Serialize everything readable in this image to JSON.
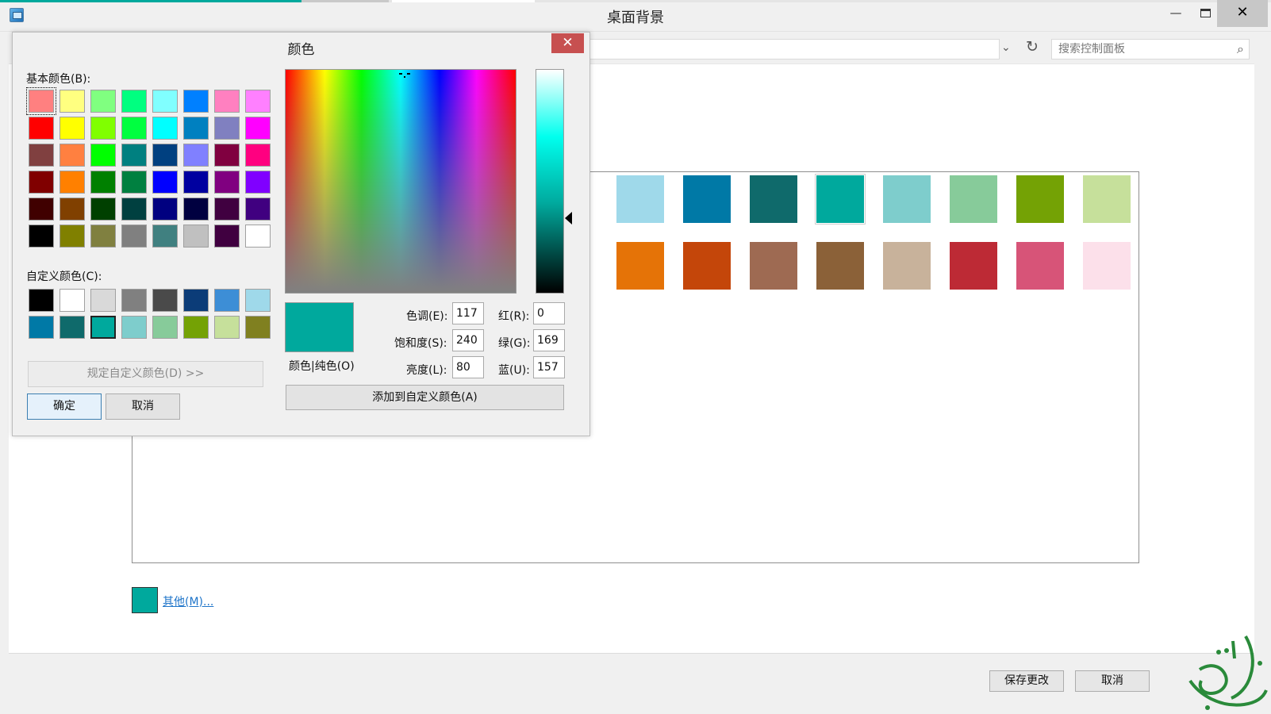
{
  "window": {
    "title": "桌面背景",
    "minimize_glyph": "—",
    "close_glyph": "✕",
    "search_placeholder": "搜索控制面板",
    "refresh_glyph": "↻",
    "chevron_glyph": "⌄",
    "search_glyph": "⌕",
    "top_strip_colors": [
      "#00a99d",
      "#c9c9c9",
      "#ffffff"
    ]
  },
  "accent_colors": {
    "row1": [
      "#9fd9ea",
      "#0079a6",
      "#0f6a6b",
      "#00a99d",
      "#7ecdcc",
      "#87cb9a",
      "#74a205",
      "#c6e09b"
    ],
    "row2": [
      "#e57307",
      "#c4460a",
      "#9e6a52",
      "#8b6138",
      "#c8b29b",
      "#bd2a35",
      "#d75478",
      "#fce0ea"
    ],
    "selected_index": 3
  },
  "other": {
    "label": "其他(M)...",
    "swatch_color": "#00a99d"
  },
  "footer": {
    "save_label": "保存更改",
    "cancel_label": "取消"
  },
  "dialog": {
    "title": "颜色",
    "close_glyph": "✕",
    "basic_label": "基本颜色(B):",
    "custom_label": "自定义颜色(C):",
    "define_label": "规定自定义颜色(D) >>",
    "ok_label": "确定",
    "cancel_label": "取消",
    "preview_label": "颜色|纯色(O)",
    "add_label": "添加到自定义颜色(A)",
    "basic_colors": [
      [
        "#ff8080",
        "#ffff80",
        "#80ff80",
        "#00ff80",
        "#80ffff",
        "#0080ff",
        "#ff80c0",
        "#ff80ff"
      ],
      [
        "#ff0000",
        "#ffff00",
        "#80ff00",
        "#00ff40",
        "#00ffff",
        "#0080c0",
        "#8080c0",
        "#ff00ff"
      ],
      [
        "#804040",
        "#ff8040",
        "#00ff00",
        "#008080",
        "#004080",
        "#8080ff",
        "#800040",
        "#ff0080"
      ],
      [
        "#800000",
        "#ff8000",
        "#008000",
        "#008040",
        "#0000ff",
        "#0000a0",
        "#800080",
        "#8000ff"
      ],
      [
        "#400000",
        "#804000",
        "#004000",
        "#004040",
        "#000080",
        "#000040",
        "#400040",
        "#400080"
      ],
      [
        "#000000",
        "#808000",
        "#808040",
        "#808080",
        "#408080",
        "#c0c0c0",
        "#400040",
        "#ffffff"
      ]
    ],
    "custom_colors": [
      [
        "#000000",
        "#ffffff",
        "#d9d9d9",
        "#808080",
        "#4a4a4a",
        "#0b3c78",
        "#3d8ed6",
        "#9fd9ea"
      ],
      [
        "#0079a6",
        "#0f6a6b",
        "#00a99d",
        "#7ecdcc",
        "#87cb9a",
        "#74a205",
        "#c6e09b",
        "#808020"
      ]
    ],
    "current_custom_index": 10,
    "preview_color": "#00a99d",
    "fields": {
      "hue_label": "色调(E):",
      "hue": "117",
      "sat_label": "饱和度(S):",
      "sat": "240",
      "lum_label": "亮度(L):",
      "lum": "80",
      "red_label": "红(R):",
      "red": "0",
      "green_label": "绿(G):",
      "green": "169",
      "blue_label": "蓝(U):",
      "blue": "157"
    }
  }
}
